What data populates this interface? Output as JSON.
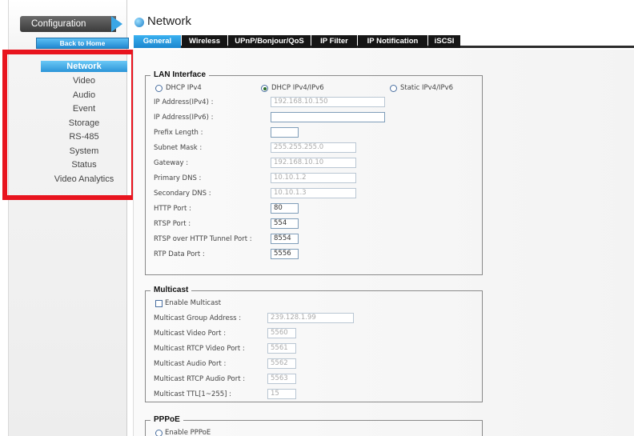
{
  "sidebar": {
    "config_label": "Configuration",
    "back_home": "Back to Home",
    "items": [
      {
        "label": "Network",
        "active": true
      },
      {
        "label": "Video"
      },
      {
        "label": "Audio"
      },
      {
        "label": "Event"
      },
      {
        "label": "Storage"
      },
      {
        "label": "RS-485"
      },
      {
        "label": "System"
      },
      {
        "label": "Status"
      },
      {
        "label": "Video Analytics"
      }
    ]
  },
  "header": {
    "title": "Network"
  },
  "tabs": [
    "General",
    "Wireless",
    "UPnP/Bonjour/QoS",
    "IP Filter",
    "IP Notification",
    "iSCSI"
  ],
  "lan": {
    "legend": "LAN Interface",
    "modes": [
      "DHCP IPv4",
      "DHCP IPv4/IPv6",
      "Static IPv4/IPv6"
    ],
    "selected_mode": "DHCP IPv4/IPv6",
    "fields": [
      {
        "label": "IP Address(IPv4) :",
        "value": ""
      },
      {
        "label": "IP Address(IPv6) :",
        "value": ""
      },
      {
        "label": "Prefix Length :",
        "value": ""
      },
      {
        "label": "Subnet Mask :",
        "value": "255.255.255.0"
      },
      {
        "label": "Gateway :",
        "value": "192.168.10.10"
      },
      {
        "label": "Primary DNS :",
        "value": "10.10.1.2"
      },
      {
        "label": "Secondary DNS :",
        "value": "10.10.1.3"
      },
      {
        "label": "HTTP Port :",
        "value": "80"
      },
      {
        "label": "RTSP Port :",
        "value": "554"
      },
      {
        "label": "RTSP over HTTP Tunnel Port :",
        "value": "8554"
      },
      {
        "label": "RTP Data Port :",
        "value": "5556"
      }
    ],
    "ipv4_value": "192.168.10.150"
  },
  "multicast": {
    "legend": "Multicast",
    "enable_label": "Enable Multicast",
    "fields": [
      {
        "label": "Multicast Group Address :",
        "value": "239.128.1.99"
      },
      {
        "label": "Multicast Video Port :",
        "value": "5560"
      },
      {
        "label": "Multicast RTCP Video Port :",
        "value": "5561"
      },
      {
        "label": "Multicast Audio Port :",
        "value": "5562"
      },
      {
        "label": "Multicast RTCP Audio Port :",
        "value": "5563"
      },
      {
        "label": "Multicast TTL[1~255] :",
        "value": "15"
      }
    ]
  },
  "pppoe": {
    "legend": "PPPoE",
    "enable_label": "Enable PPPoE"
  },
  "colors": {
    "highlight": "#e8141e",
    "accent": "#2c95d8",
    "tab_bg": "#161616"
  }
}
